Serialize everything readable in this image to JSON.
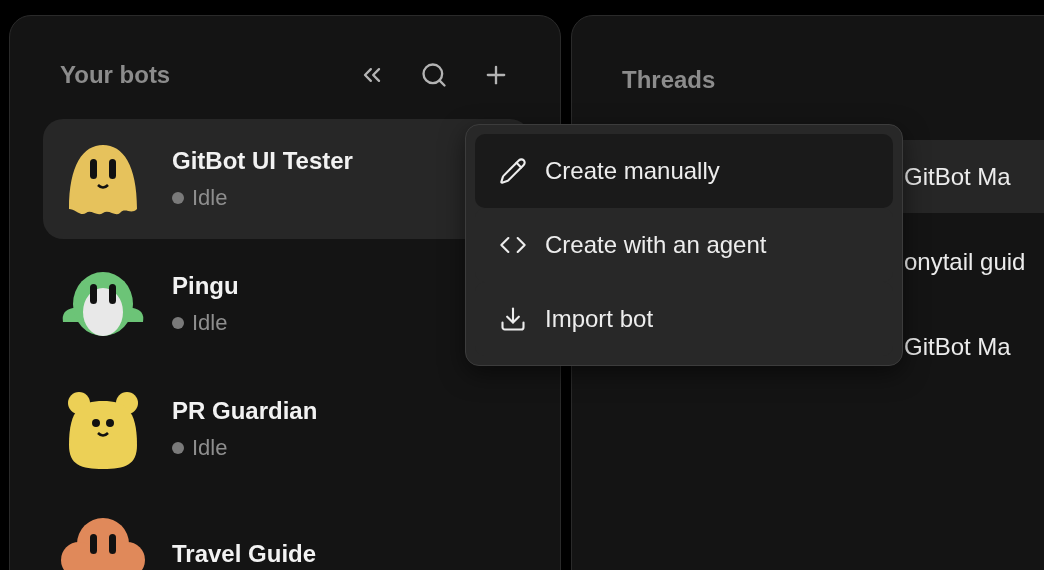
{
  "bots_panel": {
    "title": "Your bots",
    "actions": [
      {
        "kind": "collapse"
      },
      {
        "kind": "search"
      },
      {
        "kind": "add"
      }
    ],
    "bots": [
      {
        "name": "GitBot UI Tester",
        "status": "Idle",
        "selected": true,
        "kind": "ghost",
        "color": "#e6c25c"
      },
      {
        "name": "Pingu",
        "status": "Idle",
        "selected": false,
        "kind": "penguin",
        "color": "#6cc477"
      },
      {
        "name": "PR Guardian",
        "status": "Idle",
        "selected": false,
        "kind": "bear",
        "color": "#ecd056"
      },
      {
        "name": "Travel Guide",
        "selected": false,
        "kind": "cloud",
        "color": "#e0895a"
      }
    ]
  },
  "threads_panel": {
    "title": "Threads",
    "threads": [
      {
        "title": "GitBot Ma",
        "selected": true
      },
      {
        "title": "onytail guid",
        "selected": false
      },
      {
        "title": "GitBot Ma",
        "selected": false
      }
    ]
  },
  "menu": {
    "items": [
      {
        "label": "Create manually",
        "kind": "pencil",
        "selected": true
      },
      {
        "label": "Create with an agent",
        "kind": "code",
        "selected": false
      },
      {
        "label": "Import bot",
        "kind": "download",
        "selected": false
      }
    ]
  }
}
